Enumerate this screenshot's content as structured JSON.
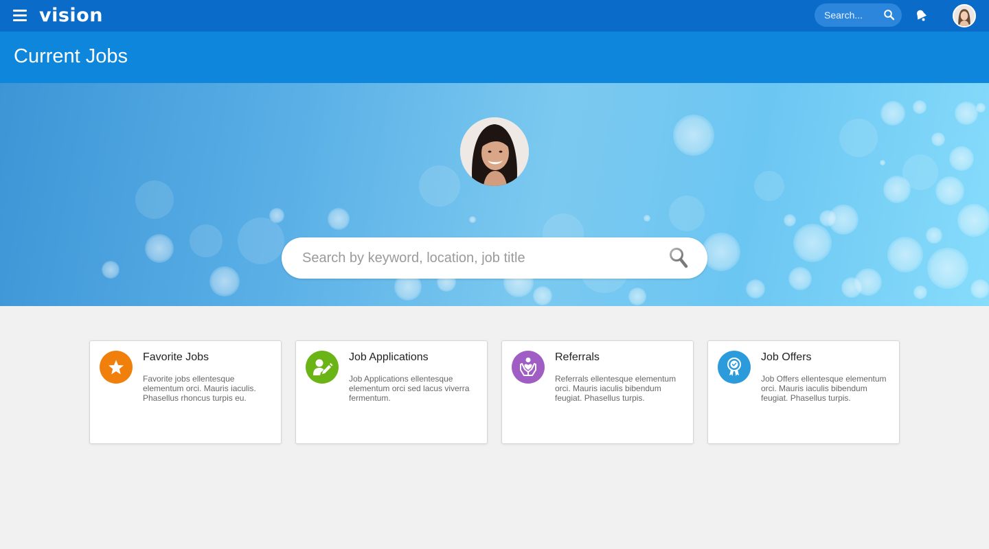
{
  "app": {
    "logo_text": "vision",
    "top_search_placeholder": "Search...",
    "menu_icon": "hamburger-menu-icon",
    "notification_icon": "bell-icon"
  },
  "page": {
    "title": "Current Jobs"
  },
  "hero": {
    "search_placeholder": "Search by keyword, location, job title"
  },
  "cards": [
    {
      "title": "Favorite Jobs",
      "description": "Favorite jobs ellentesque elementum orci. Mauris iaculis. Phasellus rhoncus turpis eu.",
      "icon": "star-icon",
      "color": "#f07f0b"
    },
    {
      "title": "Job Applications",
      "description": "Job Applications ellentesque elementum orci sed lacus viverra fermentum.",
      "icon": "user-edit-icon",
      "color": "#6bb416"
    },
    {
      "title": "Referrals",
      "description": "Referrals ellentesque elementum orci. Mauris iaculis bibendum feugiat. Phasellus turpis.",
      "icon": "hands-heart-icon",
      "color": "#a05ec4"
    },
    {
      "title": "Job Offers",
      "description": "Job Offers ellentesque elementum orci. Mauris iaculis bibendum feugiat. Phasellus turpis.",
      "icon": "award-ribbon-icon",
      "color": "#2b9bdc"
    }
  ],
  "colors": {
    "topbar": "#0a6bc9",
    "page_header": "#0d86dc",
    "background": "#f1f1f1"
  }
}
